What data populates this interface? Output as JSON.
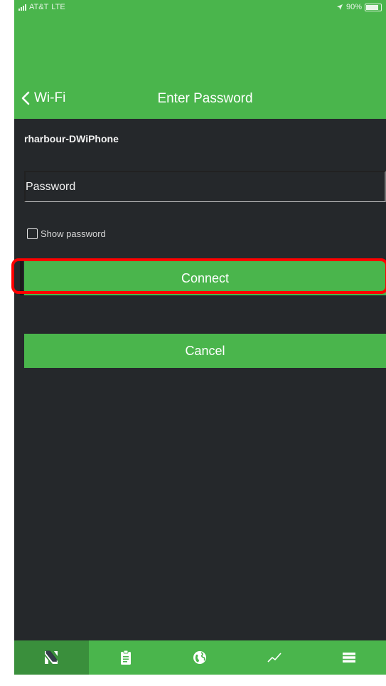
{
  "status_bar": {
    "carrier": "AT&T",
    "network": "LTE",
    "battery": "90%"
  },
  "nav": {
    "back_label": "Wi-Fi",
    "title": "Enter Password"
  },
  "form": {
    "network_name": "rharbour-DWiPhone",
    "password_placeholder": "Password",
    "password_value": "",
    "show_password_label": "Show password",
    "show_password_checked": false
  },
  "buttons": {
    "connect_label": "Connect",
    "cancel_label": "Cancel"
  },
  "tabs": [
    {
      "icon": "app-logo-icon",
      "active": true
    },
    {
      "icon": "clipboard-icon",
      "active": false
    },
    {
      "icon": "globe-icon",
      "active": false
    },
    {
      "icon": "trend-chart-icon",
      "active": false
    },
    {
      "icon": "list-icon",
      "active": false
    }
  ],
  "colors": {
    "accent_green": "#4ab54c",
    "background": "#25282b",
    "highlight": "#ff0000"
  }
}
